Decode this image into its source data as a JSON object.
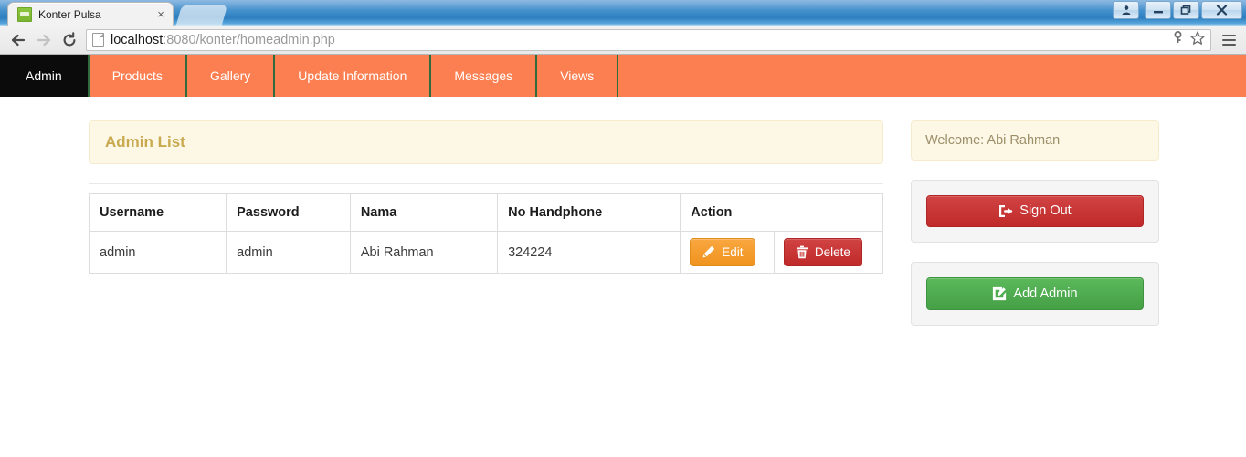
{
  "browser": {
    "tab": {
      "title": "Konter Pulsa",
      "favicon": "site-favicon",
      "close": "×"
    },
    "toolbar": {
      "back": "back-arrow-icon",
      "forward": "forward-arrow-icon",
      "reload": "reload-icon",
      "url_host": "localhost",
      "url_rest": ":8080/konter/homeadmin.php",
      "key_icon": "key-icon",
      "star_icon": "bookmark-star-icon",
      "menu_icon": "hamburger-menu-icon"
    },
    "window_controls": {
      "user": "user-account-icon",
      "minimize": "minimize-icon",
      "restore": "restore-icon",
      "close": "close-icon"
    }
  },
  "sitenav": {
    "items": [
      {
        "label": "Admin",
        "active": true
      },
      {
        "label": "Products",
        "active": false
      },
      {
        "label": "Gallery",
        "active": false
      },
      {
        "label": "Update Information",
        "active": false
      },
      {
        "label": "Messages",
        "active": false
      },
      {
        "label": "Views",
        "active": false
      }
    ]
  },
  "main": {
    "panel_title": "Admin List",
    "table": {
      "headers": [
        "Username",
        "Password",
        "Nama",
        "No Handphone",
        "Action"
      ],
      "rows": [
        {
          "username": "admin",
          "password": "admin",
          "nama": "Abi Rahman",
          "no_handphone": "324224",
          "edit_label": "Edit",
          "delete_label": "Delete"
        }
      ]
    }
  },
  "sidebar": {
    "welcome": "Welcome: Abi Rahman",
    "sign_out_label": "Sign Out",
    "add_admin_label": "Add Admin"
  },
  "colors": {
    "nav_orange": "#fb7f50",
    "nav_active": "#0b0b0b",
    "nav_separator": "#2f6b3c",
    "panel_cream": "#fdf7e5",
    "panel_cream_text": "#c9a94f",
    "btn_warning": "#f0931f",
    "btn_danger": "#c02a2a",
    "btn_success": "#46a046"
  }
}
